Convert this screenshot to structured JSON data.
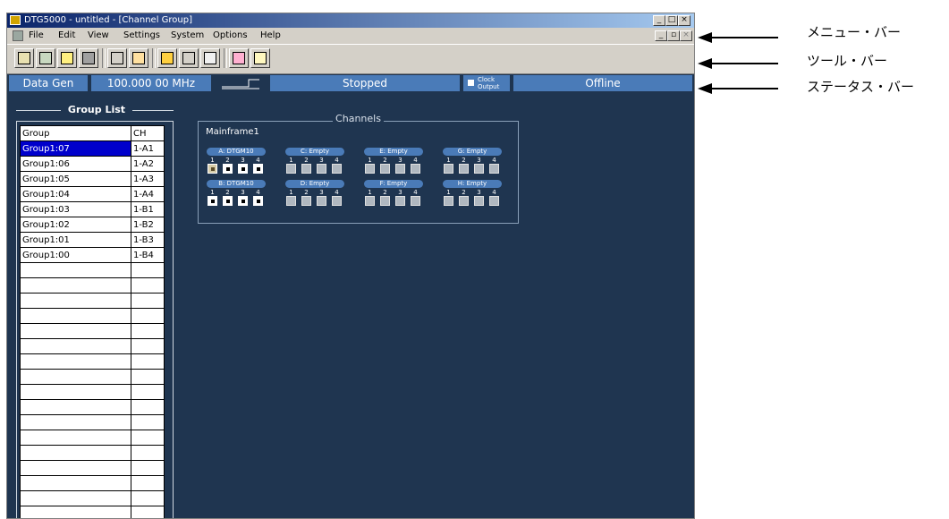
{
  "window": {
    "title": "DTG5000 - untitled - [Channel Group]"
  },
  "menu": [
    "File",
    "Edit",
    "View",
    "Settings",
    "System",
    "Options",
    "Help"
  ],
  "toolbar": {
    "buttons": [
      "waveform-icon",
      "pattern-icon",
      "group-icon",
      "timing-icon",
      "channel-icon",
      "sequence-icon",
      "edit-icon",
      "memory-icon",
      "level-icon",
      "lightning-icon",
      "help-icon"
    ]
  },
  "status": {
    "mode": "Data Gen",
    "frequency": "100.000 00 MHz",
    "run_state": "Stopped",
    "clock_output": "Clock Output",
    "clock_line1": "Clock",
    "clock_line2": "Output",
    "connection": "Offline"
  },
  "group_list": {
    "title": "Group List",
    "headers": {
      "group": "Group",
      "ch": "CH"
    },
    "rows": [
      {
        "group": "Group1:07",
        "ch": "1-A1",
        "selected": true
      },
      {
        "group": "Group1:06",
        "ch": "1-A2"
      },
      {
        "group": "Group1:05",
        "ch": "1-A3"
      },
      {
        "group": "Group1:04",
        "ch": "1-A4"
      },
      {
        "group": "Group1:03",
        "ch": "1-B1"
      },
      {
        "group": "Group1:02",
        "ch": "1-B2"
      },
      {
        "group": "Group1:01",
        "ch": "1-B3"
      },
      {
        "group": "Group1:00",
        "ch": "1-B4"
      }
    ]
  },
  "channels": {
    "title": "Channels",
    "mainframe": "Mainframe1",
    "channel_numbers": [
      "1",
      "2",
      "3",
      "4"
    ],
    "slots": [
      {
        "label": "A: DTGM10",
        "active": [
          true,
          true,
          true,
          true
        ]
      },
      {
        "label": "C: Empty",
        "active": [
          false,
          false,
          false,
          false
        ]
      },
      {
        "label": "E: Empty",
        "active": [
          false,
          false,
          false,
          false
        ]
      },
      {
        "label": "G: Empty",
        "active": [
          false,
          false,
          false,
          false
        ]
      },
      {
        "label": "B: DTGM10",
        "active": [
          true,
          true,
          true,
          true
        ]
      },
      {
        "label": "D: Empty",
        "active": [
          false,
          false,
          false,
          false
        ]
      },
      {
        "label": "F: Empty",
        "active": [
          false,
          false,
          false,
          false
        ]
      },
      {
        "label": "H: Empty",
        "active": [
          false,
          false,
          false,
          false
        ]
      }
    ]
  },
  "annotations": {
    "menu_bar": "メニュー・バー",
    "tool_bar": "ツール・バー",
    "status_bar": "ステータス・バー"
  },
  "colors": {
    "workspace": "#1f3550",
    "status_accent": "#4a7bb8",
    "selection": "#0000cc"
  }
}
